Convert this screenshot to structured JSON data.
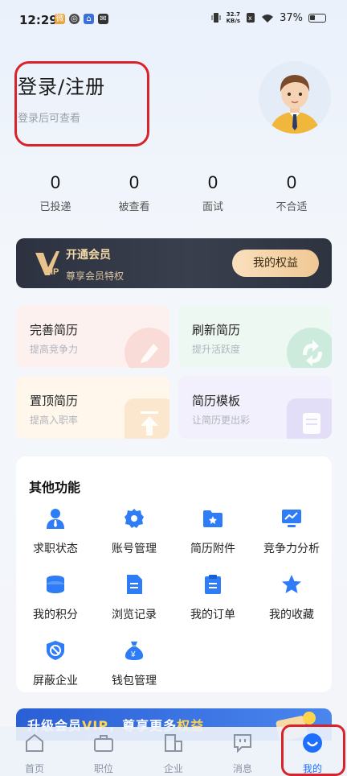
{
  "status_bar": {
    "time": "12:29",
    "net_speed_top": "32.7",
    "net_speed_bottom": "KB/s",
    "battery": "37%"
  },
  "profile": {
    "title": "登录/注册",
    "subtitle": "登录后可查看"
  },
  "stats": [
    {
      "value": "0",
      "label": "已投递"
    },
    {
      "value": "0",
      "label": "被查看"
    },
    {
      "value": "0",
      "label": "面试"
    },
    {
      "value": "0",
      "label": "不合适"
    }
  ],
  "vip": {
    "logo_text": "VIP",
    "title": "开通会员",
    "subtitle": "尊享会员特权",
    "button": "我的权益"
  },
  "quick_cards": [
    {
      "title": "完善简历",
      "subtitle": "提高竞争力",
      "icon": "pencil-icon"
    },
    {
      "title": "刷新简历",
      "subtitle": "提升活跃度",
      "icon": "refresh-icon"
    },
    {
      "title": "置顶简历",
      "subtitle": "提高入职率",
      "icon": "pin-top-icon"
    },
    {
      "title": "简历模板",
      "subtitle": "让简历更出彩",
      "icon": "document-icon"
    }
  ],
  "other_functions": {
    "title": "其他功能",
    "items": [
      {
        "label": "求职状态",
        "icon": "person-icon"
      },
      {
        "label": "账号管理",
        "icon": "gear-icon"
      },
      {
        "label": "简历附件",
        "icon": "folder-icon"
      },
      {
        "label": "竞争力分析",
        "icon": "monitor-chart-icon"
      },
      {
        "label": "我的积分",
        "icon": "coins-icon"
      },
      {
        "label": "浏览记录",
        "icon": "document-icon"
      },
      {
        "label": "我的订单",
        "icon": "clipboard-icon"
      },
      {
        "label": "我的收藏",
        "icon": "star-icon"
      },
      {
        "label": "屏蔽企业",
        "icon": "shield-block-icon"
      },
      {
        "label": "钱包管理",
        "icon": "money-bag-icon"
      }
    ]
  },
  "promo": {
    "text_a": "升级会员",
    "text_vip": "VIP",
    "text_b": "，尊享更多",
    "text_c": "权益"
  },
  "tabs": [
    {
      "label": "首页",
      "icon": "home-icon"
    },
    {
      "label": "职位",
      "icon": "briefcase-icon"
    },
    {
      "label": "企业",
      "icon": "building-icon"
    },
    {
      "label": "消息",
      "icon": "chat-icon"
    },
    {
      "label": "我的",
      "icon": "profile-smile-icon",
      "active": true
    }
  ],
  "colors": {
    "accent": "#1f6fff",
    "highlight_box": "#d9222a",
    "vip_gold": "#f0c894"
  }
}
